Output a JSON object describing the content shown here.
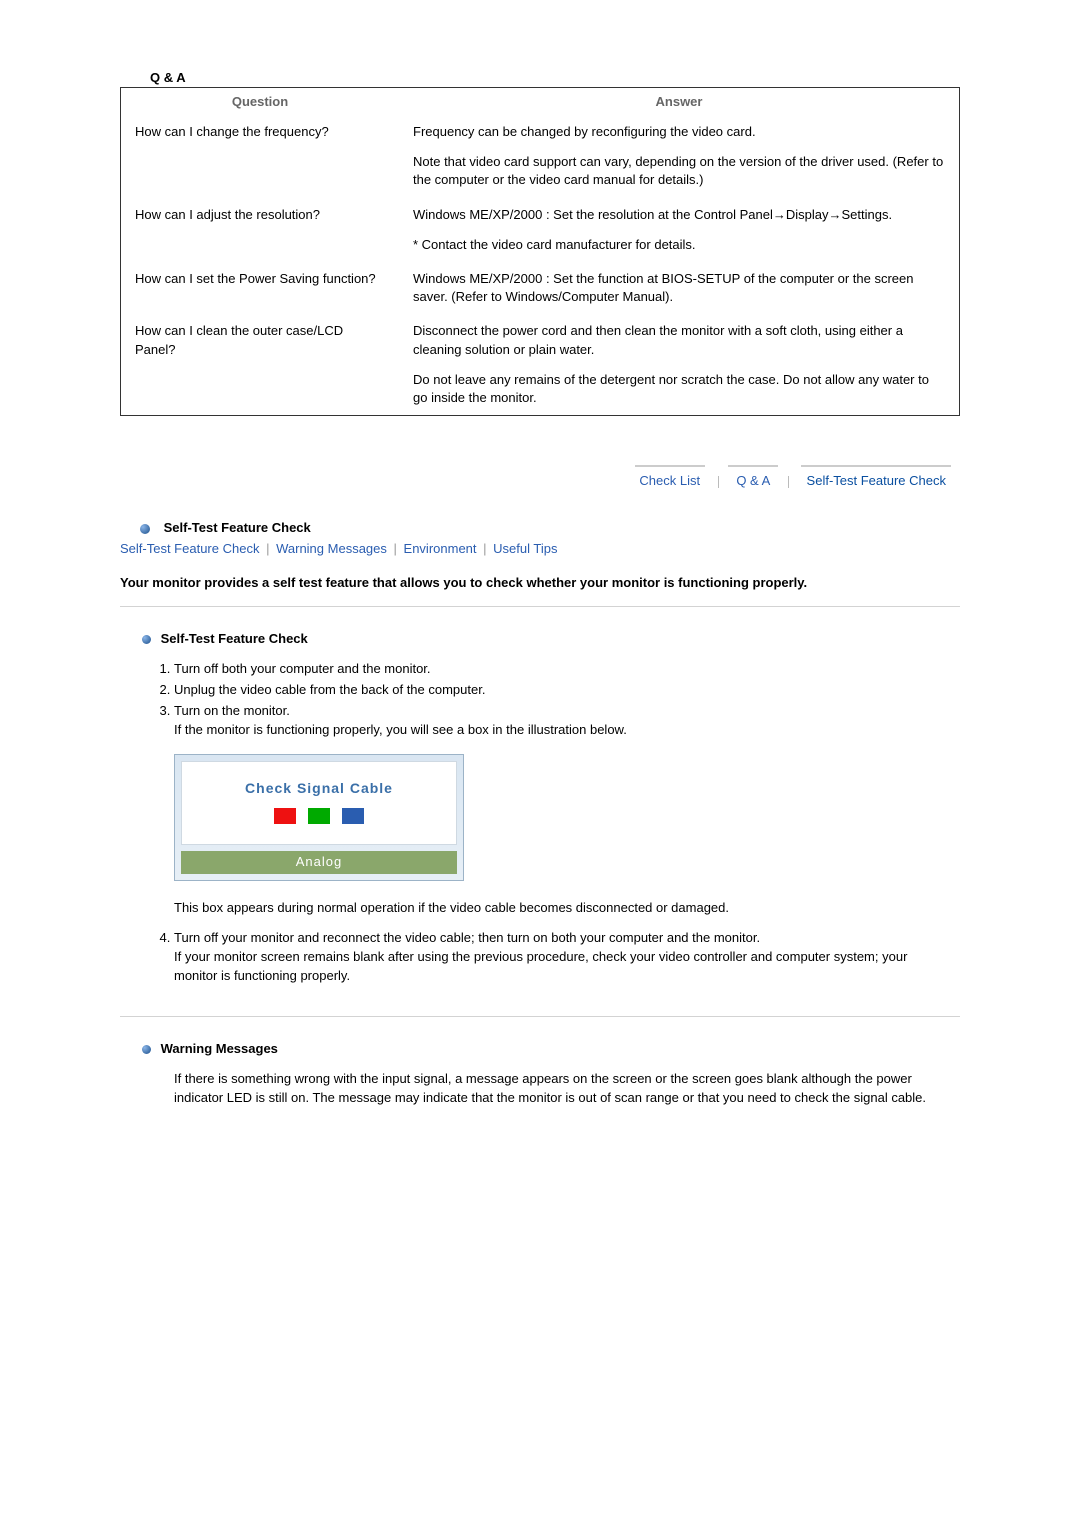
{
  "qa": {
    "title": "Q & A",
    "headers": {
      "q": "Question",
      "a": "Answer"
    },
    "rows": [
      {
        "q": "How can I change the frequency?",
        "a1": "Frequency can be changed by reconfiguring the video card.",
        "a2": "Note that video card support can vary, depending on the version of the driver used. (Refer to the computer or the video card manual for details.)"
      },
      {
        "q": "How can I adjust the resolution?",
        "a1": "Windows ME/XP/2000 : Set the resolution at the Control Panel→Display→Settings.",
        "a2": "* Contact the video card manufacturer for details."
      },
      {
        "q": "How can I set the Power Saving function?",
        "a1": "Windows ME/XP/2000 : Set the function at BIOS-SETUP of the computer or the screen saver. (Refer to Windows/Computer Manual)."
      },
      {
        "q": "How can I clean the outer case/LCD Panel?",
        "a1": "Disconnect the power cord and then clean the monitor with a soft cloth, using either a cleaning solution or plain water.",
        "a2": "Do not leave any remains of the detergent nor scratch the case. Do not allow any water to go inside the monitor."
      }
    ]
  },
  "tabs": {
    "items": [
      "Check List",
      "Q & A",
      "Self-Test Feature Check"
    ],
    "active_index": 2
  },
  "self_test": {
    "heading": "Self-Test Feature Check",
    "anchors": [
      "Self-Test Feature Check",
      "Warning Messages",
      "Environment",
      "Useful Tips"
    ],
    "intro": "Your monitor provides a self test feature that allows you to check whether your monitor is functioning properly.",
    "sub_heading": "Self-Test Feature Check",
    "steps": {
      "s1": "Turn off both your computer and the monitor.",
      "s2": "Unplug the video cable from the back of the computer.",
      "s3a": "Turn on the monitor.",
      "s3b": "If the monitor is functioning properly, you will see a box in the illustration below.",
      "box_text": "Check Signal Cable",
      "analog": "Analog",
      "s3c": "This box appears during normal operation if the video cable becomes disconnected or damaged.",
      "s4a": "Turn off your monitor and reconnect the video cable; then turn on both your computer and the monitor.",
      "s4b": "If your monitor screen remains blank after using the previous procedure, check your video controller and computer system; your monitor is functioning properly."
    }
  },
  "warning": {
    "heading": "Warning Messages",
    "text": "If there is something wrong with the input signal, a message appears on the screen or the screen goes blank although the power indicator LED is still on. The message may indicate that the monitor is out of scan range or that you need to check the signal cable."
  }
}
